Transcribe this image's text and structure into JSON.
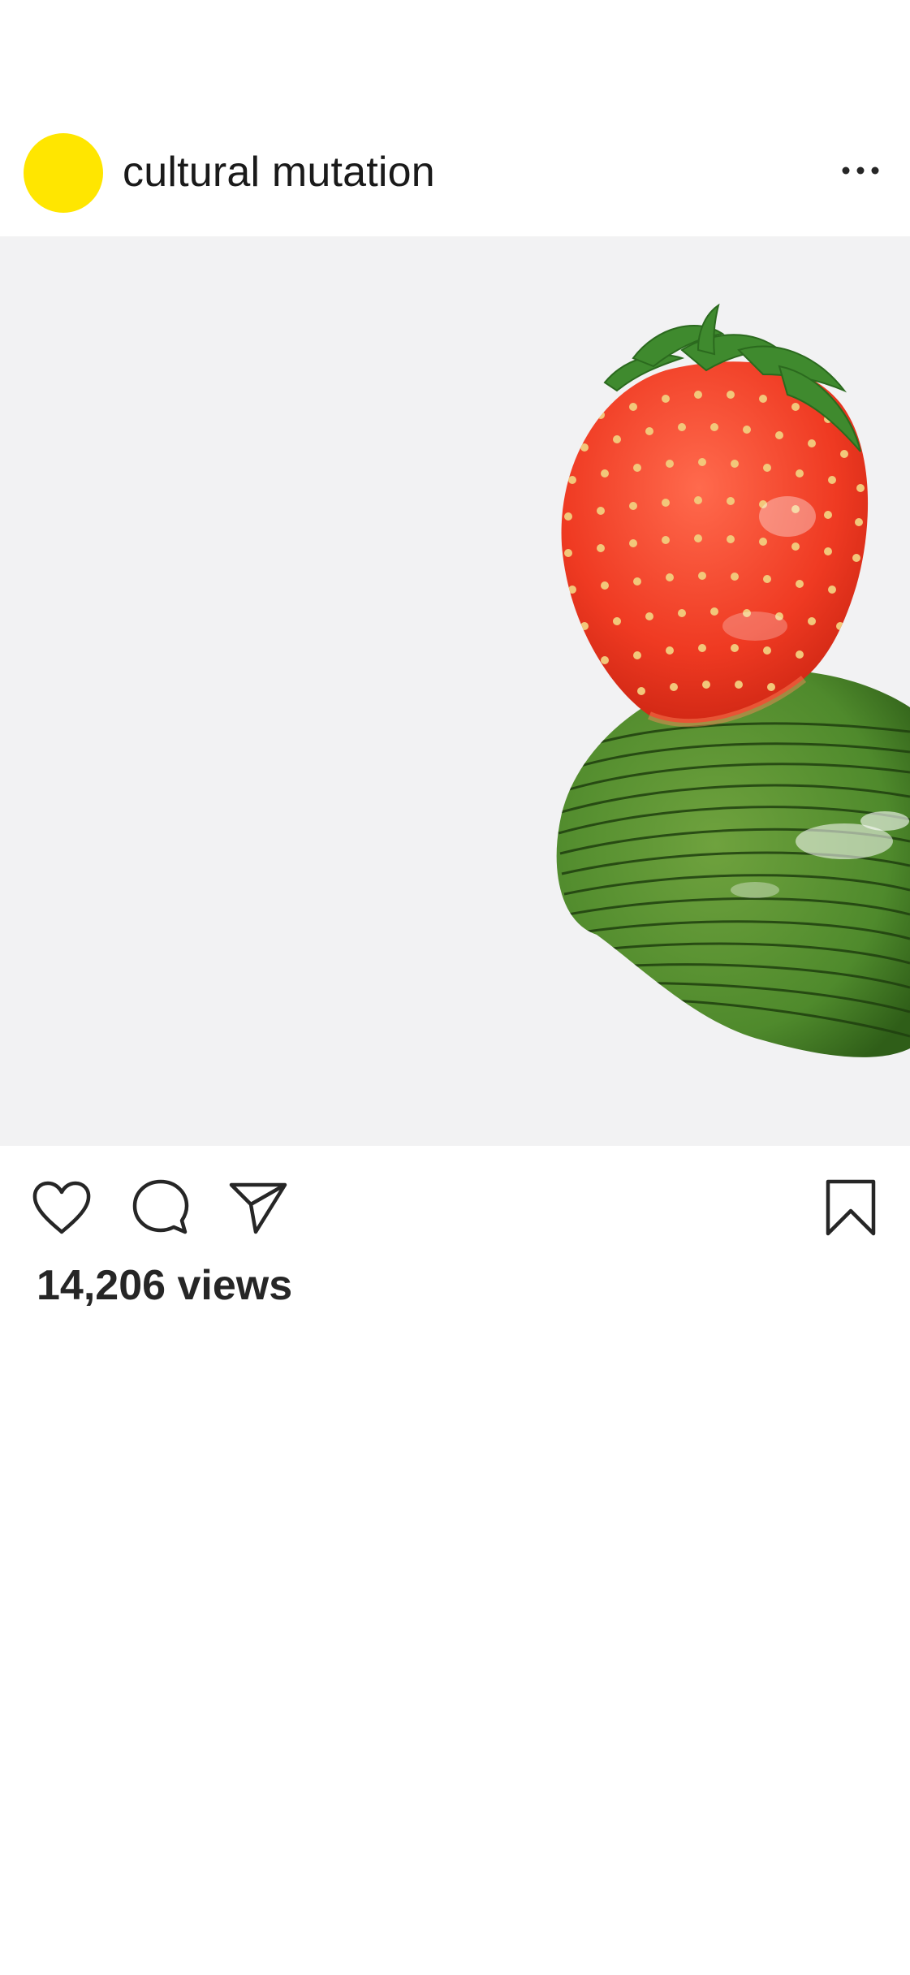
{
  "post": {
    "username": "cultural mutation",
    "avatar_color": "#FFE600",
    "more_icon": "more-horizontal-icon",
    "media_background": "#F2F2F3",
    "views_text": "14,206 views"
  },
  "actions": {
    "like_icon": "heart-icon",
    "comment_icon": "comment-icon",
    "share_icon": "paper-plane-icon",
    "save_icon": "bookmark-icon"
  }
}
